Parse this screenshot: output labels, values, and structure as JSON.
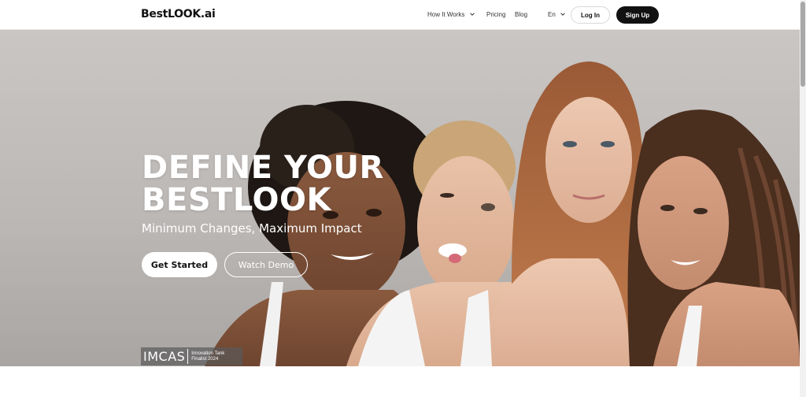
{
  "brand": {
    "logo": "BestLOOK.ai"
  },
  "nav": {
    "how_it_works": "How It Works",
    "pricing": "Pricing",
    "blog": "Blog",
    "language": "En",
    "login": "Log In",
    "signup": "Sign Up"
  },
  "hero": {
    "headline_line1": "DEFINE YOUR",
    "headline_line2": "BESTLOOK",
    "subheadline": "Minimum Changes, Maximum Impact",
    "cta_primary": "Get Started",
    "cta_secondary": "Watch Demo"
  },
  "badge": {
    "mark": "IMCAS",
    "line1": "Innovation Tank",
    "line2": "Finalist 2024"
  },
  "colors": {
    "primary_dark": "#111111",
    "hero_background": "#c4c1bf",
    "text_on_hero": "#ffffff"
  },
  "icons": {
    "dropdown": "chevron-down-icon"
  }
}
